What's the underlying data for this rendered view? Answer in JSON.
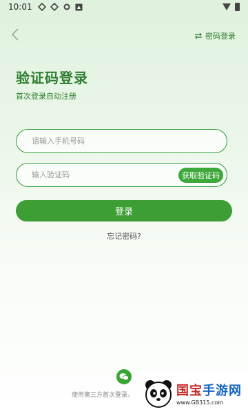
{
  "status": {
    "time": "10:01"
  },
  "header": {
    "password_login": "密码登录"
  },
  "title": "验证码登录",
  "subtitle": "首次登录自动注册",
  "phone": {
    "placeholder": "请输入手机号码"
  },
  "code": {
    "placeholder": "输入验证码",
    "get_code": "获取验证码"
  },
  "login_label": "登录",
  "forgot_label": "忘记密码?",
  "third_party_text": "使用第三方首次登录，",
  "watermark": {
    "title_part1": "国宝",
    "title_part2": "手游网",
    "url": "www.GB315.com"
  },
  "colors": {
    "accent": "#3c9e35",
    "title": "#2e7d32"
  }
}
